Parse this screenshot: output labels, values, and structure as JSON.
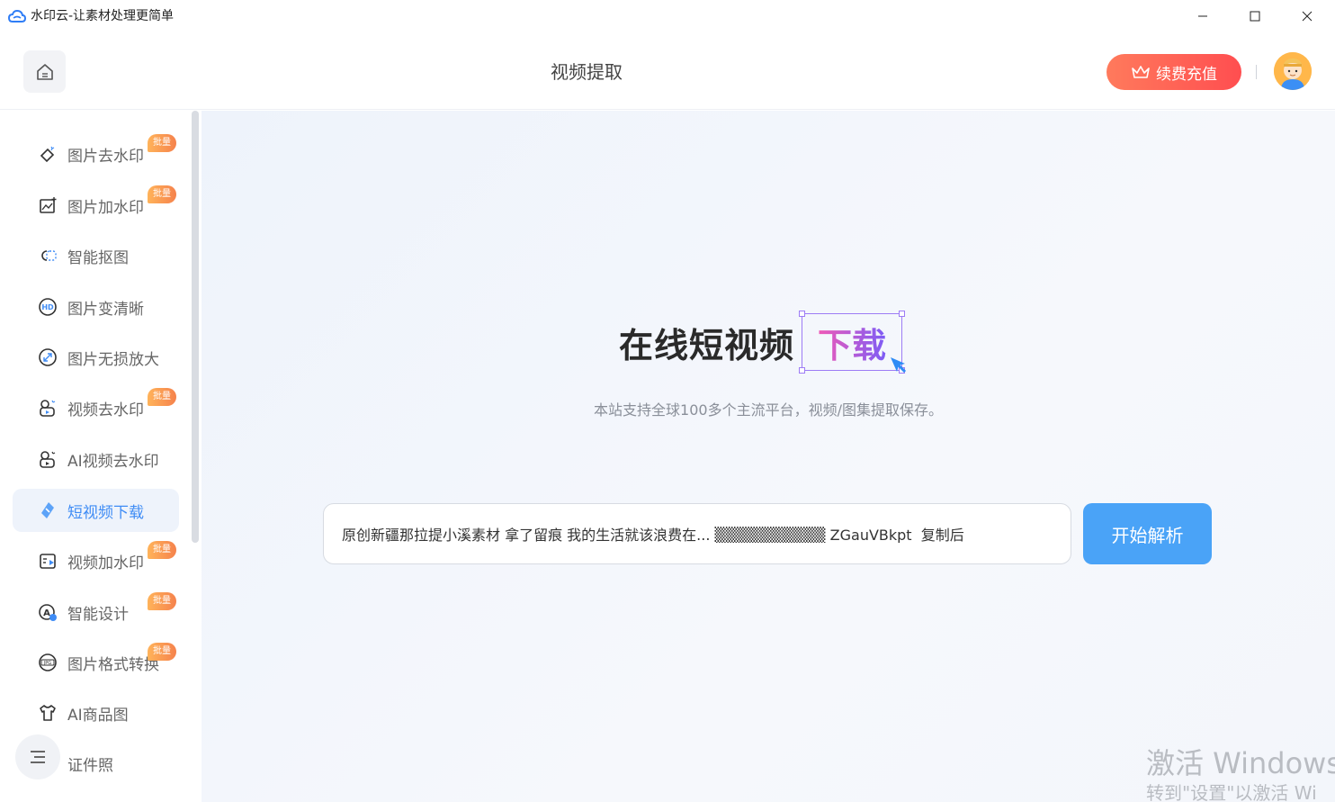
{
  "window": {
    "title": "水印云-让素材处理更简单"
  },
  "header": {
    "page_title": "视频提取",
    "recharge_label": "续费充值"
  },
  "sidebar": {
    "items": [
      {
        "label": "图片去水印",
        "badge": "批量",
        "icon": "eraser-icon"
      },
      {
        "label": "图片加水印",
        "badge": "批量",
        "icon": "image-add-icon"
      },
      {
        "label": "智能抠图",
        "badge": "",
        "icon": "cutout-icon"
      },
      {
        "label": "图片变清晰",
        "badge": "",
        "icon": "hd-icon"
      },
      {
        "label": "图片无损放大",
        "badge": "",
        "icon": "enlarge-icon"
      },
      {
        "label": "视频去水印",
        "badge": "批量",
        "icon": "video-eraser-icon"
      },
      {
        "label": "AI视频去水印",
        "badge": "",
        "icon": "ai-video-icon"
      },
      {
        "label": "短视频下载",
        "badge": "",
        "icon": "download-icon",
        "active": true
      },
      {
        "label": "视频加水印",
        "badge": "批量",
        "icon": "video-add-icon"
      },
      {
        "label": "智能设计",
        "badge": "批量",
        "icon": "design-icon"
      },
      {
        "label": "图片格式转换",
        "badge": "批量",
        "icon": "jpg-icon"
      },
      {
        "label": "AI商品图",
        "badge": "",
        "icon": "shirt-icon"
      },
      {
        "label": "证件照",
        "badge": "",
        "icon": "id-photo-icon"
      }
    ]
  },
  "main": {
    "hero_title": "在线短视频",
    "hero_highlight": "下载",
    "subtitle": "本站支持全球100多个主流平台，视频/图集提取保存。",
    "url_value": "原创新疆那拉提小溪素材 拿了留痕 我的生活就该浪费在... ▒▒▒▒▒▒▒▒▒▒ ZGauVBkpt  复制后",
    "parse_label": "开始解析"
  },
  "system": {
    "watermark_line1": "激活 Windows",
    "watermark_line2": "转到\"设置\"以激活 Wi"
  }
}
